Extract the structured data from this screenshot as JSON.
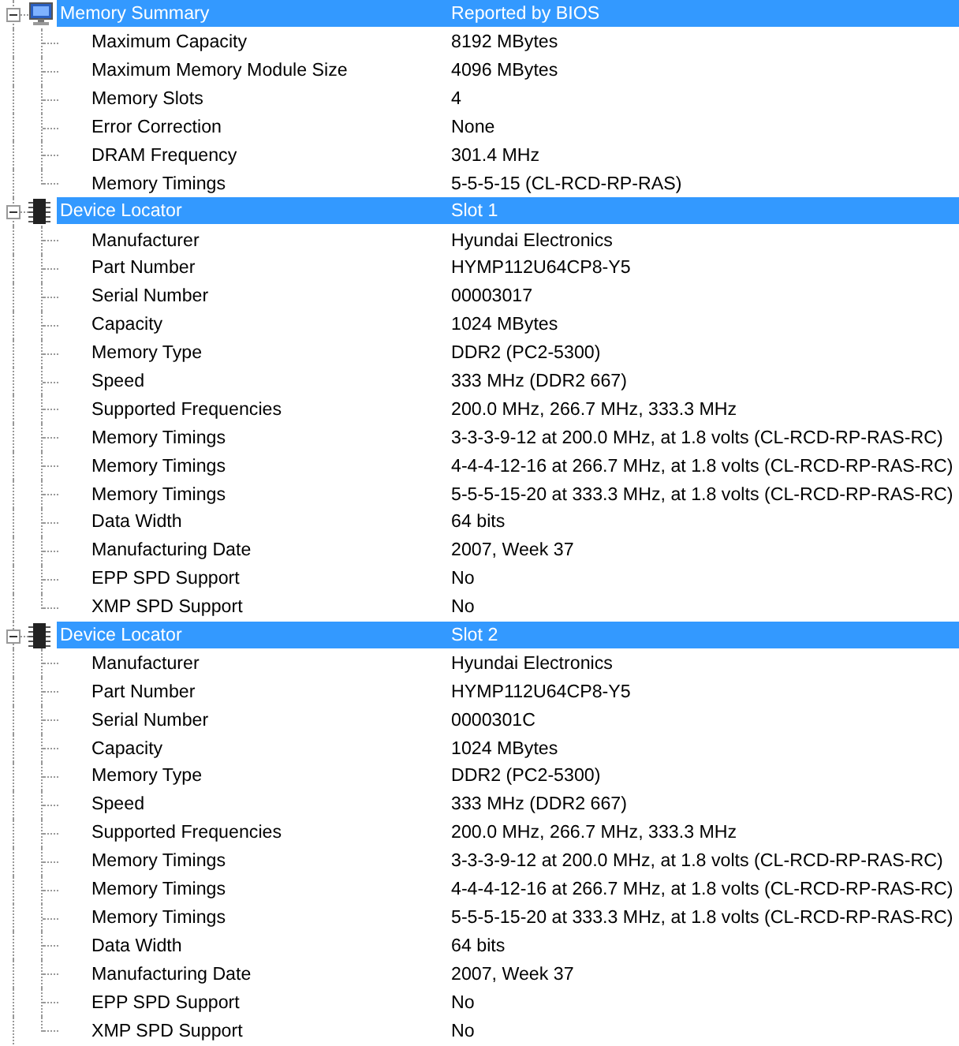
{
  "sections": [
    {
      "kind": "computer",
      "expanded": true,
      "label": "Memory Summary",
      "value": "Reported by BIOS",
      "items": [
        {
          "label": "Maximum Capacity",
          "value": "8192 MBytes"
        },
        {
          "label": "Maximum Memory Module Size",
          "value": "4096 MBytes"
        },
        {
          "label": "Memory Slots",
          "value": "4"
        },
        {
          "label": "Error Correction",
          "value": "None"
        },
        {
          "label": "DRAM Frequency",
          "value": "301.4 MHz"
        },
        {
          "label": "Memory Timings",
          "value": "5-5-5-15 (CL-RCD-RP-RAS)"
        }
      ]
    },
    {
      "kind": "chip",
      "expanded": true,
      "label": "Device Locator",
      "value": "Slot 1",
      "items": [
        {
          "label": "Manufacturer",
          "value": "Hyundai Electronics"
        },
        {
          "label": "Part Number",
          "value": "HYMP112U64CP8-Y5"
        },
        {
          "label": "Serial Number",
          "value": "00003017"
        },
        {
          "label": "Capacity",
          "value": "1024 MBytes"
        },
        {
          "label": "Memory Type",
          "value": "DDR2 (PC2-5300)"
        },
        {
          "label": "Speed",
          "value": "333 MHz (DDR2 667)"
        },
        {
          "label": "Supported Frequencies",
          "value": "200.0 MHz, 266.7 MHz, 333.3 MHz"
        },
        {
          "label": "Memory Timings",
          "value": "3-3-3-9-12 at 200.0 MHz, at 1.8 volts (CL-RCD-RP-RAS-RC)"
        },
        {
          "label": "Memory Timings",
          "value": "4-4-4-12-16 at 266.7 MHz, at 1.8 volts (CL-RCD-RP-RAS-RC)"
        },
        {
          "label": "Memory Timings",
          "value": "5-5-5-15-20 at 333.3 MHz, at 1.8 volts (CL-RCD-RP-RAS-RC)"
        },
        {
          "label": "Data Width",
          "value": "64 bits"
        },
        {
          "label": "Manufacturing Date",
          "value": "2007, Week 37"
        },
        {
          "label": "EPP SPD Support",
          "value": "No"
        },
        {
          "label": "XMP SPD Support",
          "value": "No"
        }
      ]
    },
    {
      "kind": "chip",
      "expanded": true,
      "label": "Device Locator",
      "value": "Slot 2",
      "items": [
        {
          "label": "Manufacturer",
          "value": "Hyundai Electronics"
        },
        {
          "label": "Part Number",
          "value": "HYMP112U64CP8-Y5"
        },
        {
          "label": "Serial Number",
          "value": "0000301C"
        },
        {
          "label": "Capacity",
          "value": "1024 MBytes"
        },
        {
          "label": "Memory Type",
          "value": "DDR2 (PC2-5300)"
        },
        {
          "label": "Speed",
          "value": "333 MHz (DDR2 667)"
        },
        {
          "label": "Supported Frequencies",
          "value": "200.0 MHz, 266.7 MHz, 333.3 MHz"
        },
        {
          "label": "Memory Timings",
          "value": "3-3-3-9-12 at 200.0 MHz, at 1.8 volts (CL-RCD-RP-RAS-RC)"
        },
        {
          "label": "Memory Timings",
          "value": "4-4-4-12-16 at 266.7 MHz, at 1.8 volts (CL-RCD-RP-RAS-RC)"
        },
        {
          "label": "Memory Timings",
          "value": "5-5-5-15-20 at 333.3 MHz, at 1.8 volts (CL-RCD-RP-RAS-RC)"
        },
        {
          "label": "Data Width",
          "value": "64 bits"
        },
        {
          "label": "Manufacturing Date",
          "value": "2007, Week 37"
        },
        {
          "label": "EPP SPD Support",
          "value": "No"
        },
        {
          "label": "XMP SPD Support",
          "value": "No"
        }
      ]
    }
  ]
}
